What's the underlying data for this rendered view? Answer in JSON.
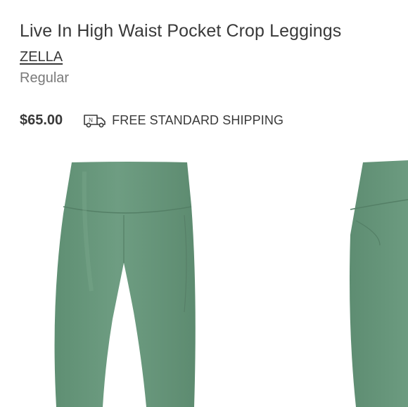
{
  "product": {
    "title": "Live In High Waist Pocket Crop Leggings",
    "brand": "ZELLA",
    "fit": "Regular",
    "price": "$65.00"
  },
  "shipping": {
    "icon": "delivery-truck-icon",
    "icon_letter": "N",
    "label": "FREE STANDARD SHIPPING"
  },
  "gallery": {
    "images": [
      {
        "view": "front",
        "color_hex": "#6b9a7e"
      },
      {
        "view": "back",
        "color_hex": "#6b9a7e"
      }
    ]
  },
  "colors": {
    "text": "#393939",
    "muted": "#7a7a7a",
    "garment": "#6b9a7e"
  }
}
